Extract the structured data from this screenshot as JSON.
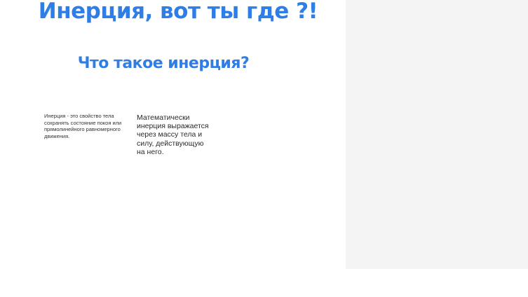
{
  "colors": {
    "title_color": "#2f7ee6",
    "side_panel_bg": "#f4f4f4"
  },
  "slide": {
    "title": "Инерция, вот ты где ?!",
    "subtitle": "Что такое инерция?",
    "definition": "Инерция - это свойство тела сохранять состояние покоя или прямолинейного равномерного движения.",
    "math_note": "Математически инерция выражается через массу тела и силу, действующую на него."
  }
}
